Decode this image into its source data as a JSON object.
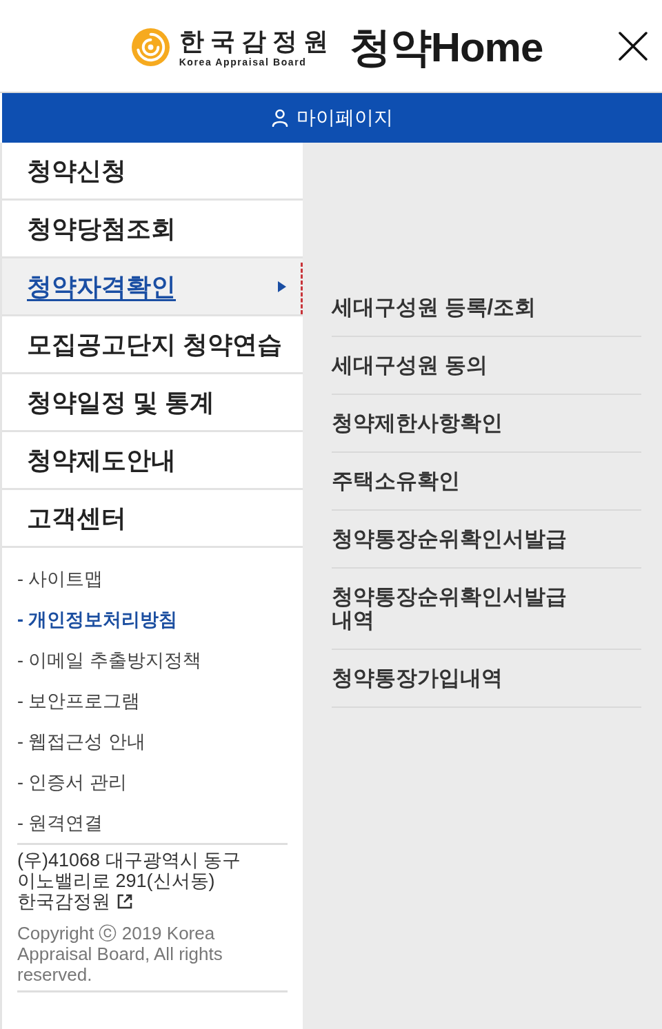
{
  "header": {
    "logo_korean": "한국감정원",
    "logo_english": "Korea Appraisal Board",
    "site_title": "청약Home"
  },
  "mypage_button": {
    "label": "마이페이지"
  },
  "menu": [
    {
      "label": "청약신청",
      "selected": false
    },
    {
      "label": "청약당첨조회",
      "selected": false
    },
    {
      "label": "청약자격확인",
      "selected": true
    },
    {
      "label": "모집공고단지 청약연습",
      "selected": false
    },
    {
      "label": "청약일정 및 통계",
      "selected": false
    },
    {
      "label": "청약제도안내",
      "selected": false
    },
    {
      "label": "고객센터",
      "selected": false
    }
  ],
  "submenu": [
    {
      "label": "세대구성원 등록/조회"
    },
    {
      "label": "세대구성원 동의"
    },
    {
      "label": "청약제한사항확인"
    },
    {
      "label": "주택소유확인"
    },
    {
      "label": "청약통장순위확인서발급"
    },
    {
      "label": "청약통장순위확인서발급 내역"
    },
    {
      "label": "청약통장가입내역"
    }
  ],
  "footer_links": [
    {
      "label": "- 사이트맵",
      "highlighted": false
    },
    {
      "label": "- 개인정보처리방침",
      "highlighted": true
    },
    {
      "label": "- 이메일 추출방지정책",
      "highlighted": false
    },
    {
      "label": "- 보안프로그램",
      "highlighted": false
    },
    {
      "label": "- 웹접근성 안내",
      "highlighted": false
    },
    {
      "label": "- 인증서 관리",
      "highlighted": false
    },
    {
      "label": "- 원격연결",
      "highlighted": false
    }
  ],
  "address": {
    "text": "(우)41068 대구광역시 동구 이노밸리로 291(신서동)",
    "link": "한국감정원"
  },
  "copyright": "Copyright ⓒ 2019 Korea Appraisal Board, All rights reserved."
}
